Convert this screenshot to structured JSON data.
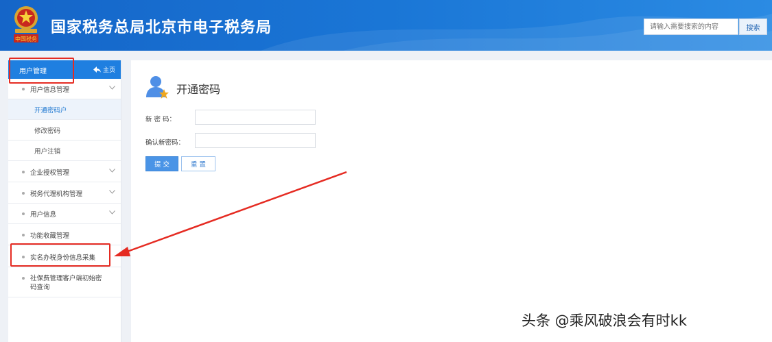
{
  "header": {
    "site_title": "国家税务总局北京市电子税务局",
    "emblem_caption": "中国税务",
    "search_placeholder": "请输入需要搜索的内容",
    "search_button": "搜索"
  },
  "sidebar": {
    "title": "用户管理",
    "home_label": "主页",
    "items": [
      {
        "label": "用户信息管理"
      },
      {
        "label": "开通密码户"
      },
      {
        "label": "修改密码"
      },
      {
        "label": "用户注销"
      },
      {
        "label": "企业授权管理"
      },
      {
        "label": "税务代理机构管理"
      },
      {
        "label": "用户信息"
      },
      {
        "label": "功能收藏管理"
      },
      {
        "label": "实名办税身份信息采集"
      },
      {
        "label": "社保费管理客户端初始密码查询"
      }
    ]
  },
  "main": {
    "title": "开通密码",
    "new_password_label": "新 密 码：",
    "confirm_password_label": "确认新密码：",
    "new_password_value": "",
    "confirm_password_value": "",
    "submit_label": "提 交",
    "reset_label": "重 置"
  },
  "watermark": "头条 @乘风破浪会有时kk",
  "colors": {
    "header_blue": "#1a76d6",
    "sidebar_head": "#1f7fe0",
    "annotation_red": "#e52b22",
    "submit_button": "#4a94e6"
  }
}
